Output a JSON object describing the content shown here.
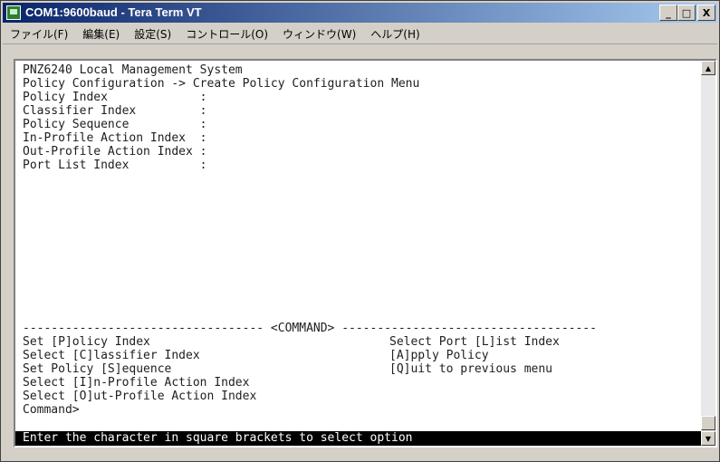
{
  "window": {
    "title": "COM1:9600baud - Tera Term VT",
    "minimize": "_",
    "maximize": "□",
    "close": "X"
  },
  "menu": [
    "ファイル(F)",
    "編集(E)",
    "設定(S)",
    "コントロール(O)",
    "ウィンドウ(W)",
    "ヘルプ(H)"
  ],
  "terminal": {
    "header": "PNZ6240 Local Management System",
    "breadcrumb": "Policy Configuration -> Create Policy Configuration Menu",
    "fields": [
      "Policy Index             :",
      "Classifier Index         :",
      "Policy Sequence          :",
      "In-Profile Action Index  :",
      "Out-Profile Action Index :",
      "Port List Index          :"
    ],
    "command_divider": "---------------------------------- <COMMAND> ------------------------------------",
    "commands_left": [
      "Set [P]olicy Index",
      "Select [C]lassifier Index",
      "Set Policy [S]equence",
      "Select [I]n-Profile Action Index",
      "Select [O]ut-Profile Action Index"
    ],
    "commands_right": [
      "Select Port [L]ist Index",
      "[A]pply Policy",
      "[Q]uit to previous menu"
    ],
    "prompt": "Command>",
    "status": "Enter the character in square brackets to select option"
  },
  "scrollbar": {
    "up_icon": "▲",
    "down_icon": "▼"
  }
}
